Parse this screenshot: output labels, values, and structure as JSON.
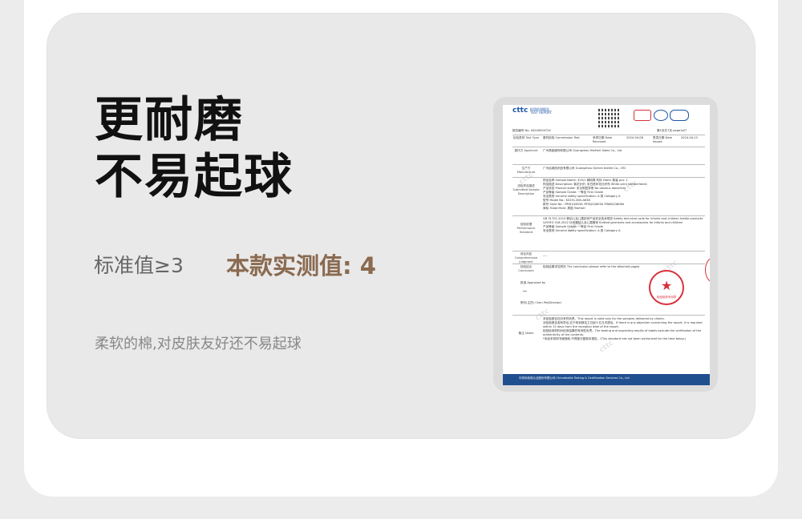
{
  "headline": {
    "line1": "更耐磨",
    "line2": "不易起球"
  },
  "stats": {
    "standard": "标准值≥3",
    "measured": "本款实测值: 4"
  },
  "description": "柔软的棉,对皮肤友好还不易起球",
  "certificate": {
    "brand": "cttc",
    "brand_sub_cn": "检验检测报告",
    "brand_sub_en": "TEST REPORT",
    "report_no": "报告编号 No. 04240004724",
    "test_type_label": "检验类别 Test Type",
    "test_type": "委托检验 Commission Test",
    "date_received_label": "来样日期 Date Received",
    "date_received": "2024-04-08",
    "date_issued_label": "签发日期 Date Issued",
    "date_issued": "2024-04-10",
    "page": "第1页共7页 page1of7",
    "applicant_label": "委托方 Applicant",
    "applicant": "广州燕瓯服饰有限公司 Guangzhou YeeHoO Sales Co., Ltd",
    "manufacturer_label": "生产方 Manufacture",
    "manufacturer": "广州启城纺织品有限公司 Guangzhou Qichen textile Co., LTD",
    "sample_label": "送检样品描述 Submitted Sample Description",
    "sample_lines": [
      "样品名称 Sample Name: 425/1 精梳棉 布料 Fabric 数量 pcs: 1",
      "样品描述 Description: 紫花针织, 米白底印花针织布 White print knitted fabric",
      "产品状态 Product state: 未见明显异常 No obvious abnormal",
      "产品等级 Sample Grade: 一等品 First Grade",
      "安全类别 General safety specification: A 类 Category A",
      "型号 Model No.: K0251-800-A638",
      "款号 Style No.: YRHJ1Q603A YRTAJ1Q603A YRABJ1Q606A",
      "商标 Trade Mark: 燕瓯 YeeHoO"
    ],
    "performance_label": "检验依据 Performance Standard",
    "performance_lines": [
      "GB 31701-2015 婴幼儿及儿童纺织产品安全技术规范 Safety technical code for infants and children textile products",
      "Q/YHFZ 018-2022 针织婴幼儿及儿童服饰 Knitted garments and accessories for infants and children",
      "产品等级 Sample Grade: 一等品 First Grade",
      "安全类别 General safety specification: A 类 Category A"
    ],
    "judgment_label": "综合判定 Comprehensive judgment",
    "judgment": "----",
    "conclusion_label": "检验结论 Conclusion",
    "conclusion": "检验结果详见附页 The conclusion please refer to the attached pages",
    "approved_label": "批准 Approved by",
    "director_label": "陈玲(主任) Chen Pei(Director)",
    "notes_label": "备注 Notes",
    "notes_lines": [
      "本检验报告仅对来样负责。This report is valid only for the samples delivered by clients.",
      "对检验报告若有异议,应于收到报告之日起十五日内提出。If there is any objection concerning the report, it is required within 15 days from the reception date of the report.",
      "检验检测机构对检测结果的有效性负责。The testing and inspecting results of labels exclude the verification of the authenticity of the contents.",
      "*未经本机构书面授权,不得部分复制本报告。(This standard has not been authorized for the time being.)"
    ],
    "stamp_text": "检验检测专用章",
    "footer": "中纺标检验认证股份有限公司 Chinatextile Testing & Certification Services Co., Ltd"
  },
  "colors": {
    "headline": "#111111",
    "measured": "#8a6a50",
    "muted": "#888888",
    "panel": "#e9e9e9",
    "cert_blue": "#1b56a4",
    "stamp_red": "#d8303a"
  }
}
